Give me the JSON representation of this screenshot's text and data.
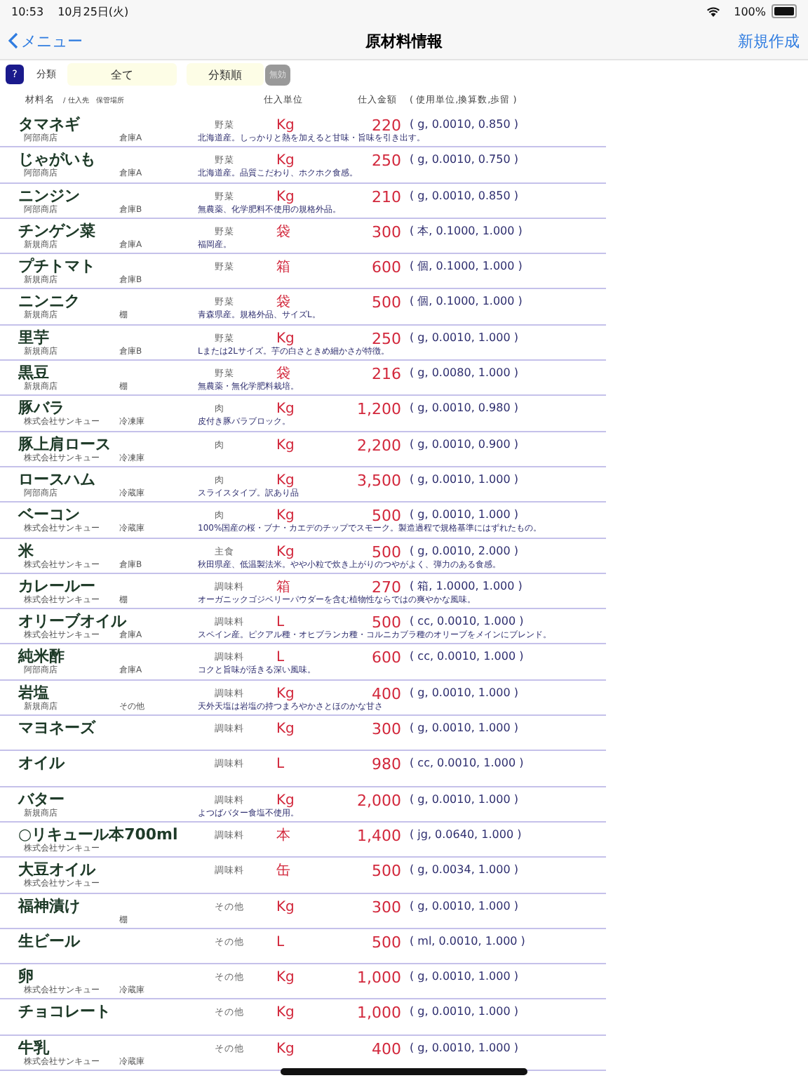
{
  "status_bar": {
    "time": "10:53",
    "date": "10月25日(火)",
    "battery": "100%"
  },
  "nav": {
    "back": "メニュー",
    "title": "原材料情報",
    "action": "新規作成"
  },
  "filter": {
    "help": "?",
    "label": "分類",
    "category": "全て",
    "sort": "分類順",
    "disable": "無効"
  },
  "columns": {
    "name": "材料名",
    "sub": "/ 仕入先　保管場所",
    "unit": "仕入単位",
    "price": "仕入金額",
    "conversion": "( 使用単位,換算数,歩留 )"
  },
  "rows": [
    {
      "name": "タマネギ",
      "category": "野菜",
      "unit": "Kg",
      "price": "220",
      "conversion": "( g, 0.0010, 0.850 )",
      "supplier": "阿部商店",
      "storage": "倉庫A",
      "note": "北海道産。しっかりと熱を加えると甘味・旨味を引き出す。"
    },
    {
      "name": "じゃがいも",
      "category": "野菜",
      "unit": "Kg",
      "price": "250",
      "conversion": "( g, 0.0010, 0.750 )",
      "supplier": "阿部商店",
      "storage": "倉庫A",
      "note": "北海道産。品質こだわり、ホクホク食感。"
    },
    {
      "name": "ニンジン",
      "category": "野菜",
      "unit": "Kg",
      "price": "210",
      "conversion": "( g, 0.0010, 0.850 )",
      "supplier": "阿部商店",
      "storage": "倉庫B",
      "note": "無農薬、化学肥料不使用の規格外品。"
    },
    {
      "name": "チンゲン菜",
      "category": "野菜",
      "unit": "袋",
      "price": "300",
      "conversion": "( 本, 0.1000, 1.000 )",
      "supplier": "新規商店",
      "storage": "倉庫A",
      "note": "福岡産。"
    },
    {
      "name": "プチトマト",
      "category": "野菜",
      "unit": "箱",
      "price": "600",
      "conversion": "( 個, 0.1000, 1.000 )",
      "supplier": "新規商店",
      "storage": "倉庫B"
    },
    {
      "name": "ニンニク",
      "category": "野菜",
      "unit": "袋",
      "price": "500",
      "conversion": "( 個, 0.1000, 1.000 )",
      "supplier": "新規商店",
      "storage": "棚",
      "note": "青森県産。規格外品、サイズL。"
    },
    {
      "name": "里芋",
      "category": "野菜",
      "unit": "Kg",
      "price": "250",
      "conversion": "( g, 0.0010, 1.000 )",
      "supplier": "新規商店",
      "storage": "倉庫B",
      "note": "Lまたは2Lサイズ。芋の白さときめ細かさが特徴。"
    },
    {
      "name": "黒豆",
      "category": "野菜",
      "unit": "袋",
      "price": "216",
      "conversion": "( g, 0.0080, 1.000 )",
      "supplier": "新規商店",
      "storage": "棚",
      "note": "無農薬・無化学肥料栽培。"
    },
    {
      "name": "豚バラ",
      "category": "肉",
      "unit": "Kg",
      "price": "1,200",
      "conversion": "( g, 0.0010, 0.980 )",
      "supplier": "株式会社サンキュー",
      "storage": "冷凍庫",
      "note": "皮付き豚バラブロック。"
    },
    {
      "name": "豚上肩ロース",
      "category": "肉",
      "unit": "Kg",
      "price": "2,200",
      "conversion": "( g, 0.0010, 0.900 )",
      "supplier": "株式会社サンキュー",
      "storage": "冷凍庫"
    },
    {
      "name": "ロースハム",
      "category": "肉",
      "unit": "Kg",
      "price": "3,500",
      "conversion": "( g, 0.0010, 1.000 )",
      "supplier": "阿部商店",
      "storage": "冷蔵庫",
      "note": "スライスタイプ。訳あり品"
    },
    {
      "name": "ベーコン",
      "category": "肉",
      "unit": "Kg",
      "price": "500",
      "conversion": "( g, 0.0010, 1.000 )",
      "supplier": "株式会社サンキュー",
      "storage": "冷蔵庫",
      "note": "100%国産の桜・ブナ・カエデのチップでスモーク。製造過程で規格基準にはずれたもの。"
    },
    {
      "name": "米",
      "category": "主食",
      "unit": "Kg",
      "price": "500",
      "conversion": "( g, 0.0010, 2.000 )",
      "supplier": "株式会社サンキュー",
      "storage": "倉庫B",
      "note": "秋田県産、低温製法米。やや小粒で炊き上がりのつやがよく、弾力のある食感。"
    },
    {
      "name": "カレールー",
      "category": "調味料",
      "unit": "箱",
      "price": "270",
      "conversion": "( 箱, 1.0000, 1.000 )",
      "supplier": "株式会社サンキュー",
      "storage": "棚",
      "note": "オーガニックゴジベリーパウダーを含む植物性ならではの爽やかな風味。"
    },
    {
      "name": "オリーブオイル",
      "category": "調味料",
      "unit": "L",
      "price": "500",
      "conversion": "( cc, 0.0010, 1.000 )",
      "supplier": "株式会社サンキュー",
      "storage": "倉庫A",
      "note": "スペイン産。ピクアル種・オヒブランカ種・コルニカブラ種のオリーブをメインにブレンド。"
    },
    {
      "name": "純米酢",
      "category": "調味料",
      "unit": "L",
      "price": "600",
      "conversion": "( cc, 0.0010, 1.000 )",
      "supplier": "阿部商店",
      "storage": "倉庫A",
      "note": "コクと旨味が活きる深い風味。"
    },
    {
      "name": "岩塩",
      "category": "調味料",
      "unit": "Kg",
      "price": "400",
      "conversion": "( g, 0.0010, 1.000 )",
      "supplier": "新規商店",
      "storage": "その他",
      "note": "天外天塩は岩塩の持つまろやかさとほのかな甘さ"
    },
    {
      "name": "マヨネーズ",
      "category": "調味料",
      "unit": "Kg",
      "price": "300",
      "conversion": "( g, 0.0010, 1.000 )"
    },
    {
      "name": "オイル",
      "category": "調味料",
      "unit": "L",
      "price": "980",
      "conversion": "( cc, 0.0010, 1.000 )"
    },
    {
      "name": "バター",
      "category": "調味料",
      "unit": "Kg",
      "price": "2,000",
      "conversion": "( g, 0.0010, 1.000 )",
      "supplier": "新規商店",
      "note": "よつばバター食塩不使用。"
    },
    {
      "name": "○リキュール本700ml",
      "category": "調味料",
      "unit": "本",
      "price": "1,400",
      "conversion": "( jg, 0.0640, 1.000 )",
      "supplier": "株式会社サンキュー"
    },
    {
      "name": "大豆オイル",
      "category": "調味料",
      "unit": "缶",
      "price": "500",
      "conversion": "( g, 0.0034, 1.000 )",
      "supplier": "株式会社サンキュー"
    },
    {
      "name": "福神漬け",
      "category": "その他",
      "unit": "Kg",
      "price": "300",
      "conversion": "( g, 0.0010, 1.000 )",
      "storage": "棚"
    },
    {
      "name": "生ビール",
      "category": "その他",
      "unit": "L",
      "price": "500",
      "conversion": "( ml, 0.0010, 1.000 )"
    },
    {
      "name": "卵",
      "category": "その他",
      "unit": "Kg",
      "price": "1,000",
      "conversion": "( g, 0.0010, 1.000 )",
      "supplier": "株式会社サンキュー",
      "storage": "冷蔵庫"
    },
    {
      "name": "チョコレート",
      "category": "その他",
      "unit": "Kg",
      "price": "1,000",
      "conversion": "( g, 0.0010, 1.000 )"
    },
    {
      "name": "牛乳",
      "category": "その他",
      "unit": "Kg",
      "price": "400",
      "conversion": "( g, 0.0010, 1.000 )",
      "supplier": "株式会社サンキュー",
      "storage": "冷蔵庫"
    }
  ]
}
